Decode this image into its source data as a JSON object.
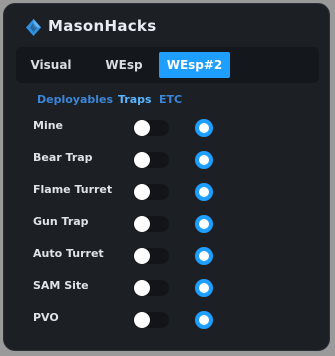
{
  "app": {
    "title": "MasonHacks",
    "logo_icon": "diamond-logo-icon"
  },
  "tabs": [
    {
      "label": "Visual",
      "active": false
    },
    {
      "label": "WEsp",
      "active": false
    },
    {
      "label": "WEsp#2",
      "active": true
    }
  ],
  "subtabs": [
    {
      "label": "Deployables",
      "active": false
    },
    {
      "label": "Traps",
      "active": true
    },
    {
      "label": "ETC",
      "active": false
    }
  ],
  "items": [
    {
      "label": "Mine",
      "toggle_on": false,
      "radio_selected": true
    },
    {
      "label": "Bear Trap",
      "toggle_on": false,
      "radio_selected": true
    },
    {
      "label": "Flame Turret",
      "toggle_on": false,
      "radio_selected": true
    },
    {
      "label": "Gun Trap",
      "toggle_on": false,
      "radio_selected": true
    },
    {
      "label": "Auto Turret",
      "toggle_on": false,
      "radio_selected": true
    },
    {
      "label": "SAM Site",
      "toggle_on": false,
      "radio_selected": true
    },
    {
      "label": "PVO",
      "toggle_on": false,
      "radio_selected": true
    }
  ],
  "colors": {
    "accent": "#1e9fff",
    "background": "#1c2025",
    "panel": "#14171b",
    "subtab_link": "#3b86d8"
  }
}
